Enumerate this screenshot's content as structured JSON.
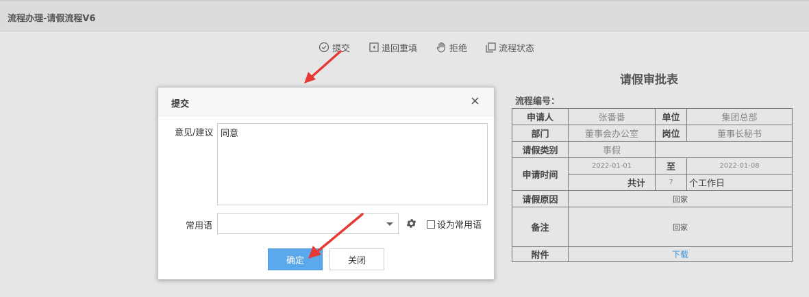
{
  "page": {
    "title": "流程办理-请假流程V6"
  },
  "toolbar": {
    "submit": "提交",
    "return_refill": "退回重填",
    "reject": "拒绝",
    "flow_status": "流程状态"
  },
  "form": {
    "title": "请假审批表",
    "flow_no_label": "流程编号：",
    "applicant_label": "申请人",
    "applicant": "张番番",
    "unit_label": "单位",
    "unit": "集团总部",
    "dept_label": "部门",
    "dept": "董事会办公室",
    "post_label": "岗位",
    "post": "董事长秘书",
    "leave_type_label": "请假类别",
    "leave_type": "事假",
    "apply_time_label": "申请时间",
    "start_date": "2022-01-01",
    "to_label": "至",
    "end_date": "2022-01-08",
    "total_label": "共计",
    "days": "7",
    "days_unit": "个工作日",
    "reason_label": "请假原因",
    "reason": "回家",
    "remark_label": "备注",
    "remark": "回家",
    "attachment_label": "附件",
    "attachment_link": "下载"
  },
  "dialog": {
    "title": "提交",
    "close_symbol": "×",
    "opinion_label": "意见/建议",
    "opinion_value": "同意",
    "common_phrase_label": "常用语",
    "common_phrase_value": "",
    "set_common_label": "设为常用语",
    "confirm": "确定",
    "close": "关闭"
  },
  "colors": {
    "primary_button": "#5aa9ec",
    "annotation_arrow": "#e53935",
    "link": "#3b8fd6"
  }
}
